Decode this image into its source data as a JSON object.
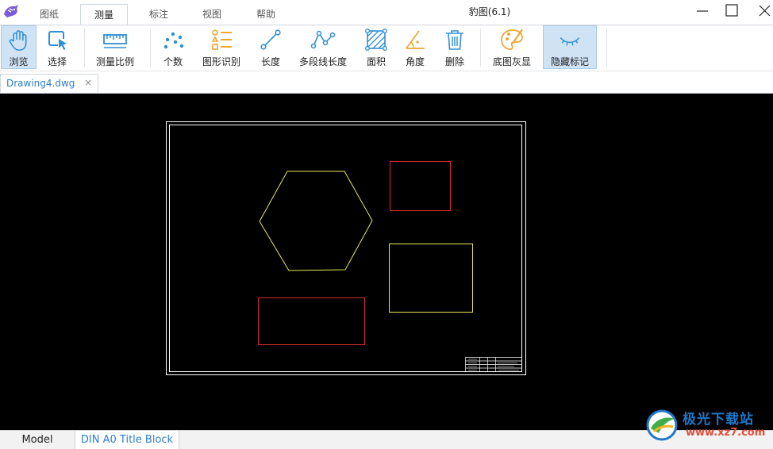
{
  "window": {
    "title": "豹图(6.1)",
    "controls": [
      "minimize",
      "maximize",
      "close"
    ]
  },
  "menu": {
    "tabs": [
      {
        "label": "图纸",
        "active": false
      },
      {
        "label": "测量",
        "active": true
      },
      {
        "label": "标注",
        "active": false
      },
      {
        "label": "视图",
        "active": false
      },
      {
        "label": "帮助",
        "active": false
      }
    ]
  },
  "ribbon": {
    "browse": {
      "label": "浏览",
      "icon": "hand-icon",
      "pressed": true
    },
    "select": {
      "label": "选择",
      "icon": "cursor-select-icon"
    },
    "scale": {
      "label": "测量比例",
      "icon": "ruler-icon"
    },
    "count": {
      "label": "个数",
      "icon": "dots-count-icon"
    },
    "shape_recognition": {
      "label": "图形识别",
      "icon": "shape-list-icon"
    },
    "length": {
      "label": "长度",
      "icon": "line-length-icon"
    },
    "polyline_length": {
      "label": "多段线长度",
      "icon": "polyline-icon"
    },
    "area": {
      "label": "面积",
      "icon": "area-hatch-icon"
    },
    "angle": {
      "label": "角度",
      "icon": "angle-icon"
    },
    "delete": {
      "label": "删除",
      "icon": "trash-icon"
    },
    "grayscale": {
      "label": "底图灰显",
      "icon": "palette-icon"
    },
    "hide_marks": {
      "label": "隐藏标记",
      "icon": "closed-eye-icon",
      "pressed": true
    }
  },
  "document_tabs": [
    {
      "label": "Drawing4.dwg",
      "close": "×",
      "active": true
    }
  ],
  "layout_tabs": [
    {
      "label": "Model",
      "active": false
    },
    {
      "label": "DIN A0 Title Block",
      "active": true
    }
  ],
  "drawing": {
    "background": "#000000",
    "border_color": "#ffffff",
    "yellow": "#e8e85a",
    "red": "#d42a2a"
  },
  "watermark": {
    "brand": "极光下载站",
    "url": "www.xz7.com"
  },
  "colors": {
    "accent": "#2f7ec9",
    "icon_blue": "#2e8fd6",
    "icon_orange": "#f0a531",
    "pressed_bg": "#cfe3f5"
  }
}
